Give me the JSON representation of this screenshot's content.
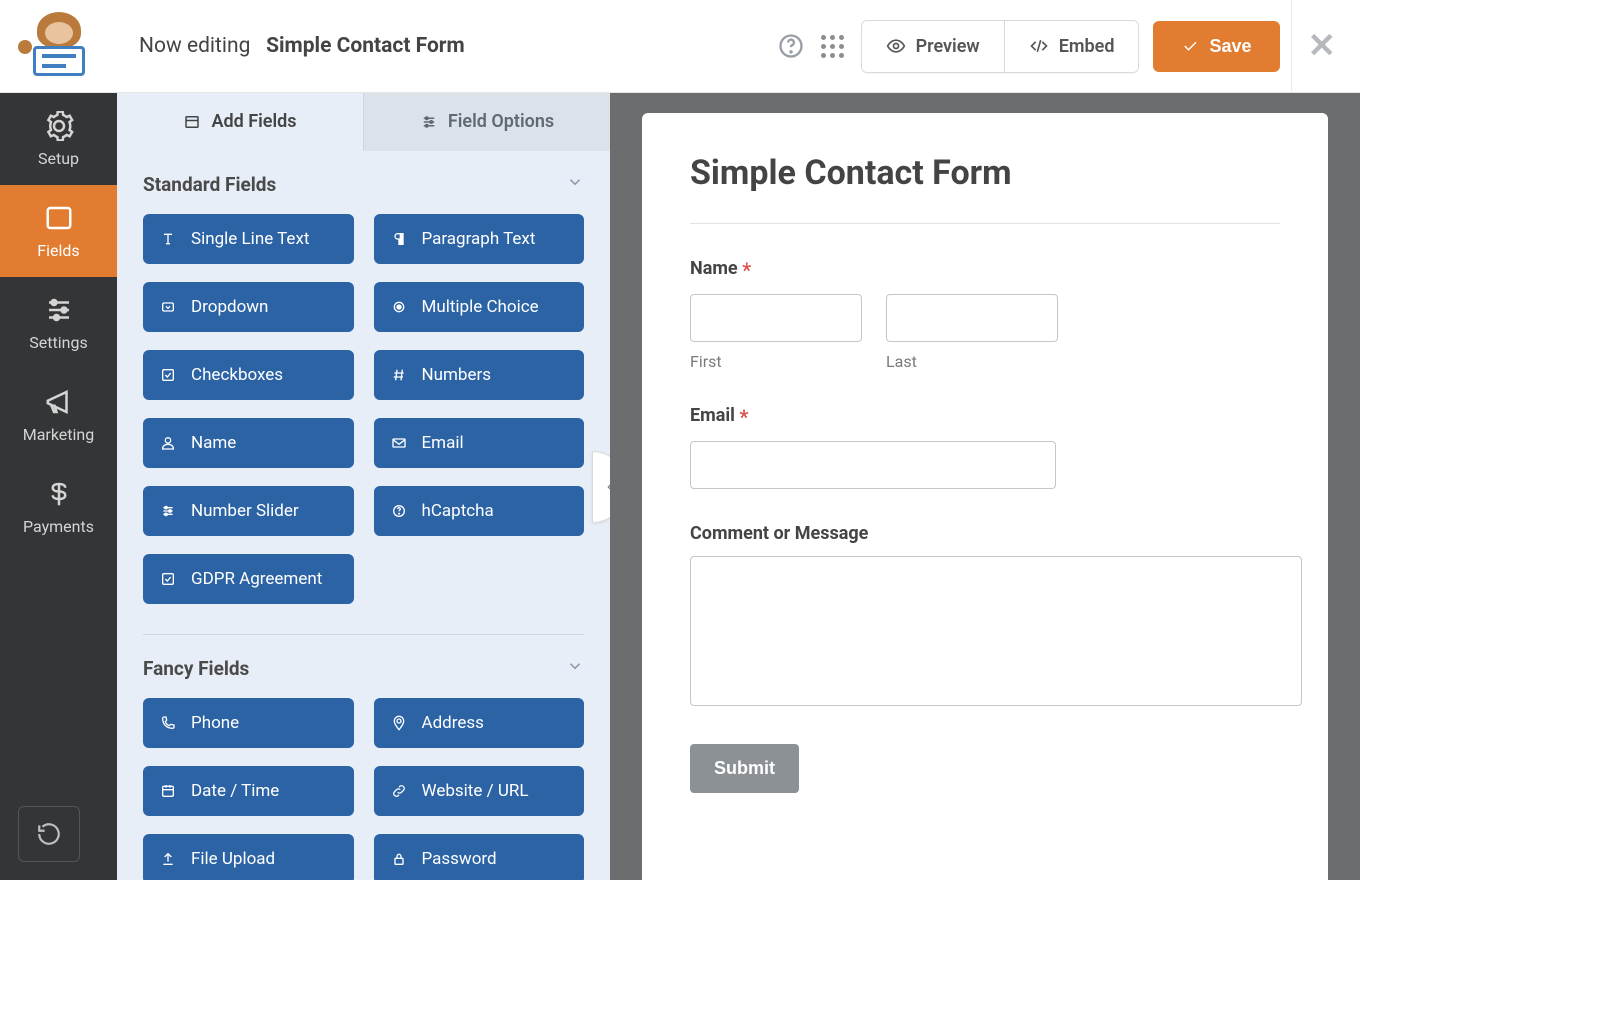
{
  "header": {
    "editing_prefix": "Now editing",
    "form_name": "Simple Contact Form",
    "preview_label": "Preview",
    "embed_label": "Embed",
    "save_label": "Save"
  },
  "nav": {
    "items": [
      {
        "id": "setup",
        "label": "Setup"
      },
      {
        "id": "fields",
        "label": "Fields"
      },
      {
        "id": "settings",
        "label": "Settings"
      },
      {
        "id": "marketing",
        "label": "Marketing"
      },
      {
        "id": "payments",
        "label": "Payments"
      }
    ],
    "active_id": "fields"
  },
  "tabs": {
    "add_fields": "Add Fields",
    "field_options": "Field Options",
    "active": "add_fields"
  },
  "sections": {
    "standard": {
      "title": "Standard Fields",
      "fields": [
        {
          "icon": "text",
          "label": "Single Line Text"
        },
        {
          "icon": "paragraph",
          "label": "Paragraph Text"
        },
        {
          "icon": "dropdown",
          "label": "Dropdown"
        },
        {
          "icon": "radio",
          "label": "Multiple Choice"
        },
        {
          "icon": "checkbox",
          "label": "Checkboxes"
        },
        {
          "icon": "hash",
          "label": "Numbers"
        },
        {
          "icon": "user",
          "label": "Name"
        },
        {
          "icon": "envelope",
          "label": "Email"
        },
        {
          "icon": "sliders",
          "label": "Number Slider"
        },
        {
          "icon": "question",
          "label": "hCaptcha"
        },
        {
          "icon": "check",
          "label": "GDPR Agreement"
        }
      ]
    },
    "fancy": {
      "title": "Fancy Fields",
      "fields": [
        {
          "icon": "phone",
          "label": "Phone"
        },
        {
          "icon": "pin",
          "label": "Address"
        },
        {
          "icon": "calendar",
          "label": "Date / Time"
        },
        {
          "icon": "link",
          "label": "Website / URL"
        },
        {
          "icon": "upload",
          "label": "File Upload"
        },
        {
          "icon": "lock",
          "label": "Password"
        }
      ]
    }
  },
  "form": {
    "title": "Simple Contact Form",
    "name_label": "Name",
    "first_sub": "First",
    "last_sub": "Last",
    "email_label": "Email",
    "comment_label": "Comment or Message",
    "submit_label": "Submit"
  },
  "glyphs": {
    "required": "*"
  }
}
